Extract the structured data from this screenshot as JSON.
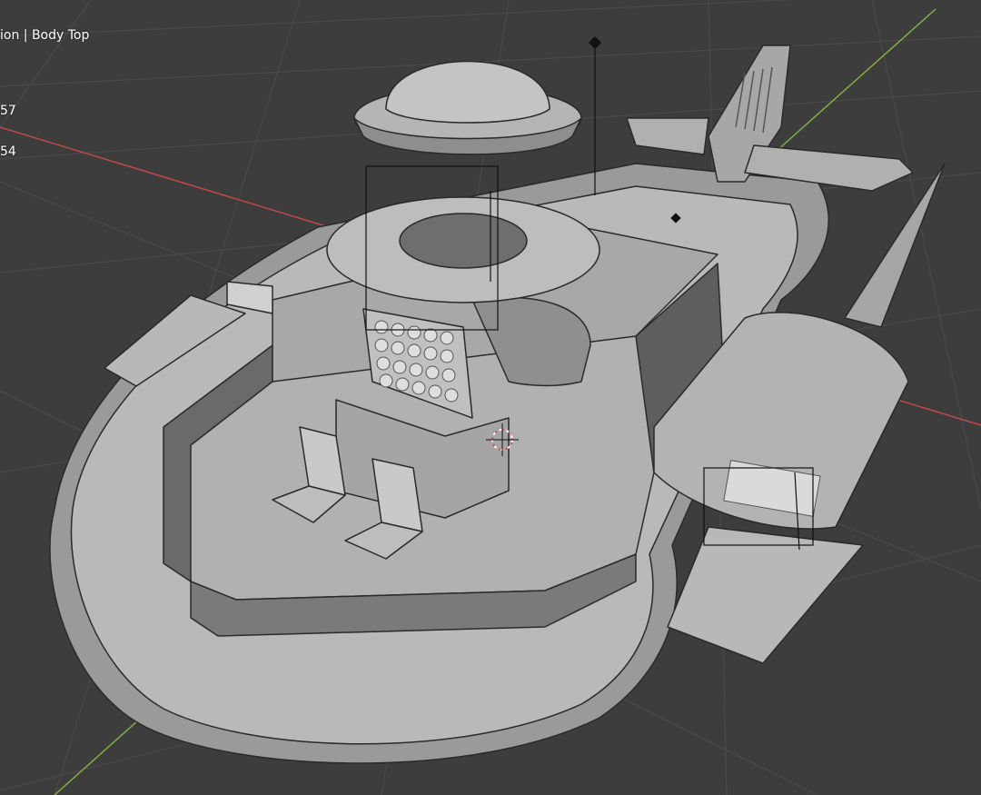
{
  "viewport": {
    "title": "ion | Body Top",
    "stat_line_1": "57",
    "stat_line_2": "54"
  },
  "colors": {
    "background": "#3d3d3d",
    "grid_line": "#4a4a4a",
    "x_axis": "#c04848",
    "y_axis": "#7fb040",
    "model_light": "#b9b9b9",
    "model_mid": "#9a9a9a",
    "model_dark": "#5e5e5e",
    "edge": "#2a2a2a",
    "cursor_red": "#d84040"
  },
  "icons": {
    "cursor": "3d-cursor-icon",
    "empty": "empty-object-icon",
    "light": "light-object-icon"
  }
}
